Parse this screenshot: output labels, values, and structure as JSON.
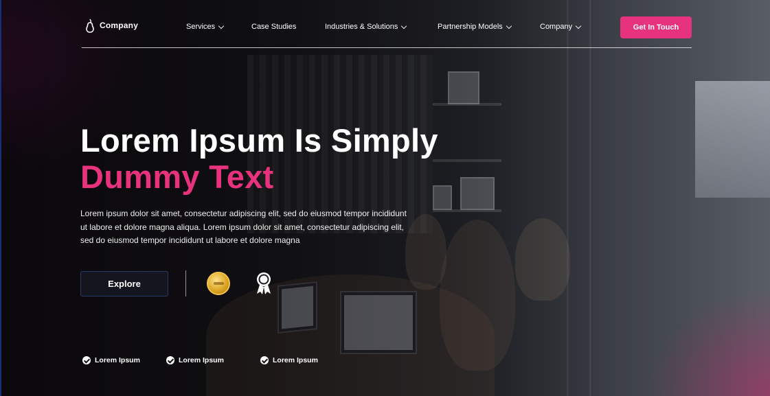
{
  "brand": {
    "name": "Company",
    "icon": "pear-icon"
  },
  "nav": {
    "items": [
      {
        "label": "Services",
        "has_dropdown": true
      },
      {
        "label": "Case Studies",
        "has_dropdown": false
      },
      {
        "label": "Industries & Solutions",
        "has_dropdown": true
      },
      {
        "label": "Partnership Models",
        "has_dropdown": true
      },
      {
        "label": "Company",
        "has_dropdown": true
      }
    ],
    "cta_label": "Get In Touch"
  },
  "hero": {
    "headline_line1": "Lorem Ipsum Is Simply",
    "headline_line2": "Dummy Text",
    "lead": "Lorem ipsum dolor sit amet, consectetur adipiscing elit, sed do eiusmod tempor incididunt ut labore et dolore magna aliqua. Lorem ipsum dolor sit amet, consectetur adipiscing elit, sed do eiusmod tempor incididunt ut labore et dolore magna",
    "explore_label": "Explore",
    "badges": [
      "gold-medal-icon",
      "award-ribbon-icon"
    ]
  },
  "features": [
    "Lorem Ipsum",
    "Lorem Ipsum",
    "Lorem Ipsum"
  ],
  "colors": {
    "accent": "#e7337d",
    "explore_bg": "#14151f",
    "text": "#ffffff"
  }
}
